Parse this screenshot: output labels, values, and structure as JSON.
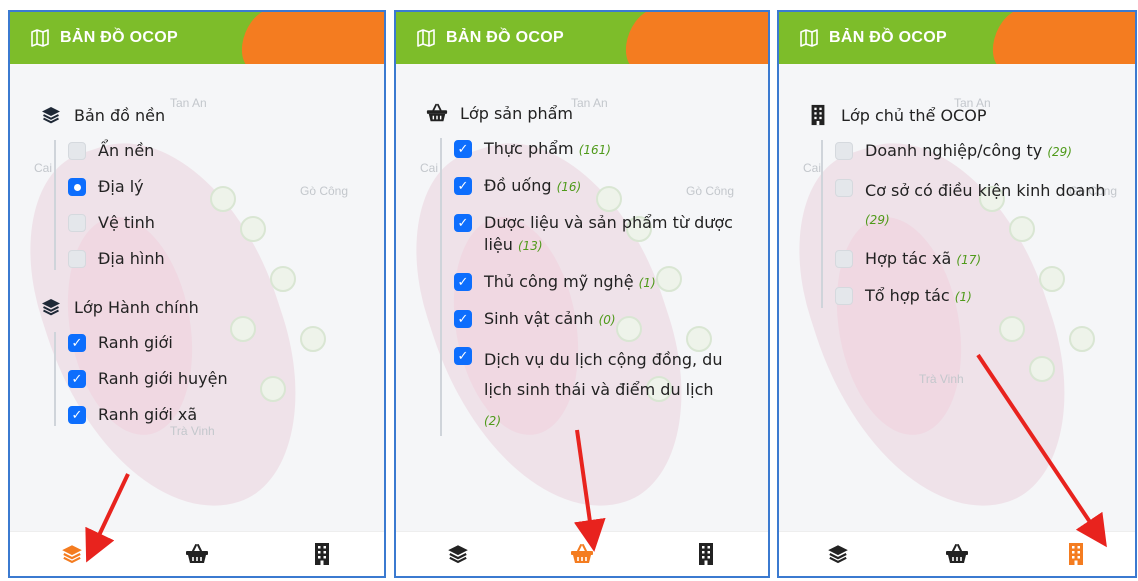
{
  "header": {
    "title": "BẢN ĐỒ OCOP"
  },
  "map_labels": {
    "tan_an": "Tan An",
    "go_cong": "Gò Công",
    "tra_vinh": "Trà Vinh",
    "cai": "Cai"
  },
  "panel1": {
    "basemap": {
      "title": "Bản đồ nền",
      "options": [
        {
          "label": "Ẩn nền",
          "selected": false
        },
        {
          "label": "Địa lý",
          "selected": true
        },
        {
          "label": "Vệ tinh",
          "selected": false
        },
        {
          "label": "Địa hình",
          "selected": false
        }
      ]
    },
    "admin": {
      "title": "Lớp Hành chính",
      "options": [
        {
          "label": "Ranh giới",
          "checked": true
        },
        {
          "label": "Ranh giới huyện",
          "checked": true
        },
        {
          "label": "Ranh giới xã",
          "checked": true
        }
      ]
    }
  },
  "panel2": {
    "title": "Lớp sản phẩm",
    "options": [
      {
        "label": "Thực phẩm",
        "count": "(161)",
        "checked": true
      },
      {
        "label": "Đồ uống",
        "count": "(16)",
        "checked": true
      },
      {
        "label": "Dược liệu và sản phẩm từ dược liệu",
        "count": "(13)",
        "checked": true
      },
      {
        "label": "Thủ công mỹ nghệ",
        "count": "(1)",
        "checked": true
      },
      {
        "label": "Sinh vật cảnh",
        "count": "(0)",
        "checked": true
      },
      {
        "label": "Dịch vụ du lịch cộng đồng, du lịch sinh thái và điểm du lịch",
        "count": "(2)",
        "checked": true
      }
    ]
  },
  "panel3": {
    "title": "Lớp chủ thể OCOP",
    "options": [
      {
        "label": "Doanh nghiệp/công ty",
        "count": "(29)",
        "checked": false
      },
      {
        "label": "Cơ sở có điều kiện kinh doanh",
        "count": "(29)",
        "checked": false
      },
      {
        "label": "Hợp tác xã",
        "count": "(17)",
        "checked": false
      },
      {
        "label": "Tổ hợp tác",
        "count": "(1)",
        "checked": false
      }
    ]
  },
  "toolbar": {
    "icons": [
      "layers-icon",
      "basket-icon",
      "building-icon"
    ],
    "active_by_panel": [
      "layers-icon",
      "basket-icon",
      "building-icon"
    ]
  },
  "colors": {
    "header_green": "#7dbd2a",
    "header_orange": "#f47c20",
    "checkbox_blue": "#0d6efd",
    "count_green": "#4f9a1a",
    "active_tool": "#f47c20",
    "inactive_tool": "#222222",
    "arrow": "#e8231e"
  }
}
